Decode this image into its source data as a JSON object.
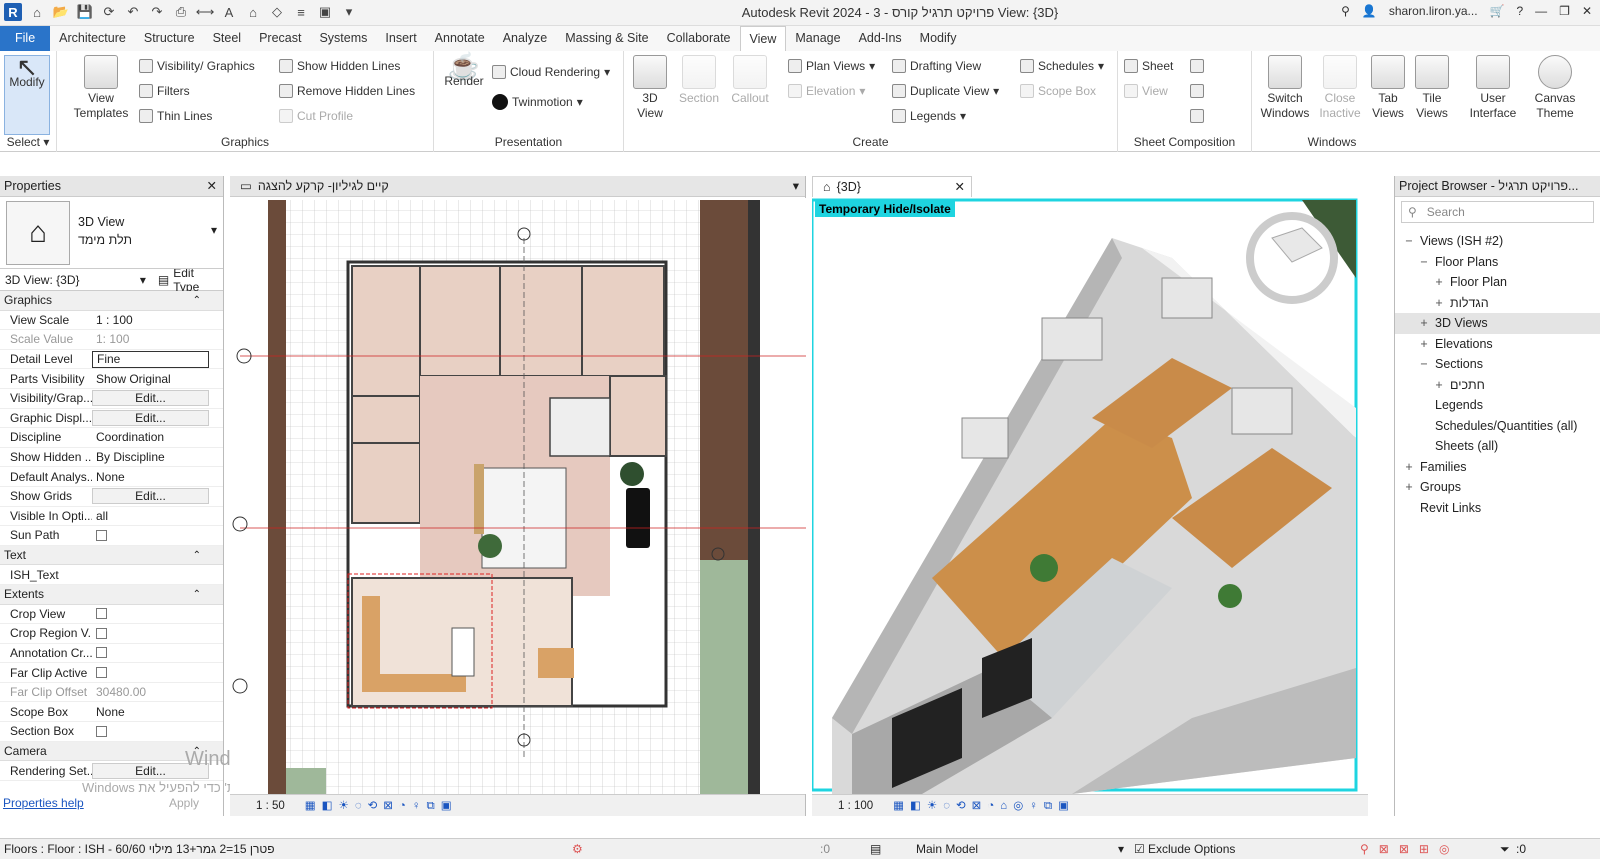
{
  "titlebar": {
    "title": "Autodesk Revit 2024 - 3 - פרויקט תרגיל קורס View: {3D}",
    "user": "sharon.liron.ya...",
    "logo": "R"
  },
  "tabs": [
    "File",
    "Architecture",
    "Structure",
    "Steel",
    "Precast",
    "Systems",
    "Insert",
    "Annotate",
    "Analyze",
    "Massing & Site",
    "Collaborate",
    "View",
    "Manage",
    "Add-Ins",
    "Modify"
  ],
  "active_tab": "View",
  "ribbon": {
    "select": {
      "modify": "Modify",
      "label": "Select"
    },
    "graphics": {
      "view_templates": "View Templates",
      "visibility": "Visibility/ Graphics",
      "filters": "Filters",
      "thin_lines": "Thin Lines",
      "show_hidden": "Show Hidden Lines",
      "remove_hidden": "Remove Hidden Lines",
      "cut_profile": "Cut Profile",
      "label": "Graphics"
    },
    "presentation": {
      "render": "Render",
      "cloud": "Cloud Rendering",
      "twinmotion": "Twinmotion",
      "label": "Presentation"
    },
    "create": {
      "view3d": "3D View",
      "section": "Section",
      "callout": "Callout",
      "plan_views": "Plan Views",
      "elevation": "Elevation",
      "drafting": "Drafting View",
      "duplicate": "Duplicate View",
      "legends": "Legends",
      "schedules": "Schedules",
      "scope_box": "Scope Box",
      "label": "Create"
    },
    "sheet": {
      "sheet": "Sheet",
      "view": "View",
      "label": "Sheet Composition"
    },
    "windows": {
      "switch": "Switch Windows",
      "close": "Close Inactive",
      "tab": "Tab Views",
      "tile": "Tile Views",
      "ui": "User Interface",
      "canvas": "Canvas Theme",
      "label": "Windows"
    }
  },
  "properties": {
    "header": "Properties",
    "type_name": "3D View",
    "type_sub": "תלת מימד",
    "selector": "3D View: {3D}",
    "edit_type": "Edit Type",
    "sections": [
      {
        "name": "Graphics",
        "rows": [
          {
            "k": "View Scale",
            "v": "1 : 100"
          },
          {
            "k": "Scale Value",
            "v": "1:  100",
            "dim": true
          },
          {
            "k": "Detail Level",
            "v": "Fine",
            "input": true
          },
          {
            "k": "Parts Visibility",
            "v": "Show Original"
          },
          {
            "k": "Visibility/Grap...",
            "v": "Edit...",
            "btn": true
          },
          {
            "k": "Graphic Displ...",
            "v": "Edit...",
            "btn": true
          },
          {
            "k": "Discipline",
            "v": "Coordination"
          },
          {
            "k": "Show Hidden ...",
            "v": "By Discipline"
          },
          {
            "k": "Default Analys...",
            "v": "None"
          },
          {
            "k": "Show Grids",
            "v": "Edit...",
            "btn": true
          },
          {
            "k": "Visible In Opti...",
            "v": "all"
          },
          {
            "k": "Sun Path",
            "v": "",
            "check": true
          }
        ]
      },
      {
        "name": "Text",
        "rows": [
          {
            "k": "ISH_Text",
            "v": ""
          }
        ]
      },
      {
        "name": "Extents",
        "rows": [
          {
            "k": "Crop View",
            "v": "",
            "check": true
          },
          {
            "k": "Crop Region V...",
            "v": "",
            "check": true
          },
          {
            "k": "Annotation Cr...",
            "v": "",
            "check": true
          },
          {
            "k": "Far Clip Active",
            "v": "",
            "check": true
          },
          {
            "k": "Far Clip Offset",
            "v": "30480.00",
            "dim": true
          },
          {
            "k": "Scope Box",
            "v": "None"
          },
          {
            "k": "Section Box",
            "v": "",
            "check": true
          }
        ]
      },
      {
        "name": "Camera",
        "rows": [
          {
            "k": "Rendering Set...",
            "v": "Edit...",
            "btn": true
          }
        ]
      }
    ],
    "help": "Properties help",
    "apply": "Apply"
  },
  "view1": {
    "title": "קיים לגיליון- קרקע להצגה",
    "scale": "1 : 50"
  },
  "view2": {
    "title": "{3D}",
    "badge": "Temporary Hide/Isolate",
    "scale": "1 : 100"
  },
  "browser": {
    "header": "Project Browser - פרויקט תרגיל...",
    "search": "Search",
    "nodes": [
      {
        "t": "−",
        "label": "Views (ISH #2)",
        "lvl": 0
      },
      {
        "t": "−",
        "label": "Floor Plans",
        "lvl": 1
      },
      {
        "t": "+",
        "label": "Floor Plan",
        "lvl": 2
      },
      {
        "t": "+",
        "label": "הגדלות",
        "lvl": 2
      },
      {
        "t": "+",
        "label": "3D Views",
        "lvl": 1,
        "sel": true
      },
      {
        "t": "+",
        "label": "Elevations",
        "lvl": 1
      },
      {
        "t": "−",
        "label": "Sections",
        "lvl": 1
      },
      {
        "t": "+",
        "label": "חתכים",
        "lvl": 2
      },
      {
        "t": "",
        "label": "Legends",
        "lvl": 1
      },
      {
        "t": "",
        "label": "Schedules/Quantities (all)",
        "lvl": 1
      },
      {
        "t": "",
        "label": "Sheets (all)",
        "lvl": 1
      },
      {
        "t": "+",
        "label": "Families",
        "lvl": 0
      },
      {
        "t": "+",
        "label": "Groups",
        "lvl": 0
      },
      {
        "t": "",
        "label": "Revit Links",
        "lvl": 0
      }
    ]
  },
  "watermark": {
    "l1": "Windows הפעל את",
    "l2": "Windows עבור אל 'הגדרות' כדי להפעיל את"
  },
  "status": {
    "left": "Floors : Floor : ISH - 60/60 פטרן 15=2 גמר+13 מילוי",
    "model": "Main Model",
    "exclude": "Exclude Options",
    "zero1": ":0",
    "filter": ":0"
  }
}
